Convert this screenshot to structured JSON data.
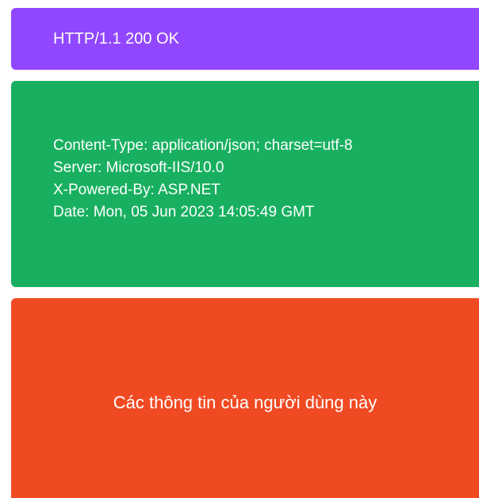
{
  "status": {
    "line": "HTTP/1.1 200 OK",
    "color": "#9147ff"
  },
  "headers": {
    "color": "#18b060",
    "lines": [
      "Content-Type: application/json; charset=utf-8",
      "Server: Microsoft-IIS/10.0",
      "X-Powered-By: ASP.NET",
      "Date: Mon, 05 Jun 2023 14:05:49 GMT"
    ]
  },
  "body": {
    "color": "#f04a23",
    "text": "Các thông tin của người dùng này"
  }
}
